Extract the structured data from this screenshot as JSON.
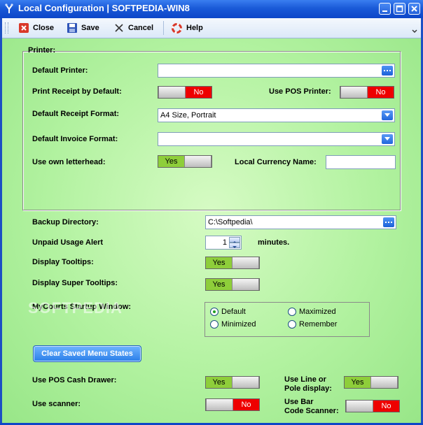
{
  "window": {
    "title": "Local Configuration  |  SOFTPEDIA-WIN8",
    "watermark": "SOFTPEDIA"
  },
  "toolbar": {
    "close_label": "Close",
    "save_label": "Save",
    "cancel_label": "Cancel",
    "help_label": "Help"
  },
  "printer_group": {
    "title": "Printer:",
    "default_printer_label": "Default Printer:",
    "default_printer_value": "",
    "print_receipt_label": "Print Receipt by Default:",
    "print_receipt_value": "No",
    "use_pos_printer_label": "Use POS Printer:",
    "use_pos_printer_value": "No",
    "receipt_format_label": "Default Receipt Format:",
    "receipt_format_value": "A4 Size, Portrait",
    "invoice_format_label": "Default Invoice Format:",
    "invoice_format_value": "",
    "letterhead_label": "Use own letterhead:",
    "letterhead_value": "Yes",
    "currency_label": "Local Currency Name:",
    "currency_value": ""
  },
  "general": {
    "backup_label": "Backup Directory:",
    "backup_value": "C:\\Softpedia\\",
    "unpaid_label": "Unpaid Usage Alert",
    "unpaid_value": "1",
    "unpaid_unit": "minutes.",
    "tooltips_label": "Display Tooltips:",
    "tooltips_value": "Yes",
    "super_tooltips_label": "Display Super Tooltips:",
    "super_tooltips_value": "Yes",
    "startup_label": "MyCourts Startup Window:",
    "startup_options": [
      "Default",
      "Maximized",
      "Minimized",
      "Remember"
    ],
    "startup_selected": "Default",
    "clear_button_label": "Clear Saved Menu States",
    "cash_drawer_label": "Use POS Cash Drawer:",
    "cash_drawer_value": "Yes",
    "line_display_label_1": "Use Line or",
    "line_display_label_2": "Pole display:",
    "line_display_value": "Yes",
    "scanner_label": "Use scanner:",
    "scanner_value": "No",
    "barcode_label_1": "Use Bar",
    "barcode_label_2": "Code Scanner:",
    "barcode_value": "No"
  },
  "colors": {
    "title_bar": "#1a5ad8",
    "toggle_yes": "#8ece3a",
    "toggle_no": "#ee0000",
    "background": "#b2f2a0"
  }
}
